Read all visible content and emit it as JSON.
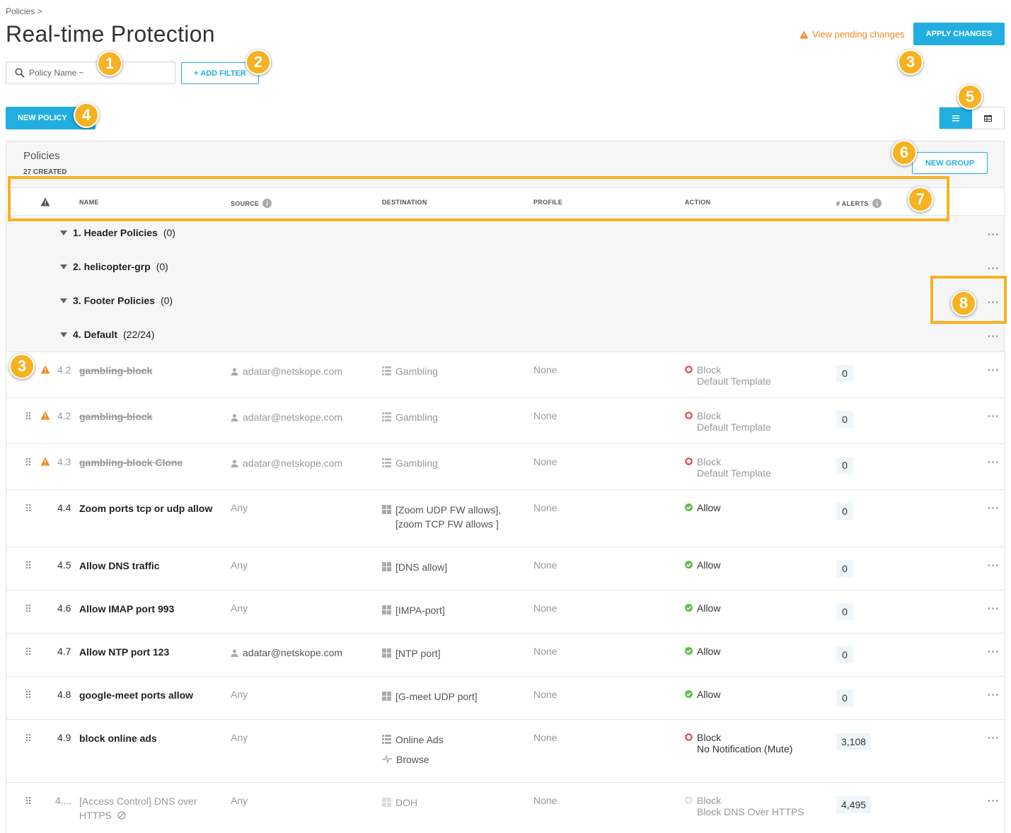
{
  "breadcrumb": "Policies >",
  "page_title": "Real-time Protection",
  "pending_link": "View pending changes",
  "apply_button": "APPLY CHANGES",
  "search": {
    "placeholder": "Policy Name ~",
    "icon": "search-icon"
  },
  "add_filter": "+ ADD FILTER",
  "new_policy": "NEW POLICY",
  "view_toggle": {
    "active": "list-view",
    "icons": [
      "list-icon",
      "table-icon"
    ]
  },
  "panel": {
    "title": "Policies",
    "subtitle": "27 CREATED",
    "new_group": "NEW GROUP"
  },
  "columns": {
    "name": "NAME",
    "source": "SOURCE",
    "destination": "DESTINATION",
    "profile": "PROFILE",
    "action": "ACTION",
    "alerts": "# ALERTS"
  },
  "groups": [
    {
      "label": "1. Header Policies",
      "count": "(0)"
    },
    {
      "label": "2. helicopter-grp",
      "count": "(0)"
    },
    {
      "label": "3. Footer Policies",
      "count": "(0)"
    },
    {
      "label": "4. Default",
      "count": "(22/24)"
    }
  ],
  "rows": [
    {
      "num": "4.2",
      "name": "gambling-block",
      "source": "adatar@netskope.com",
      "dest": "Gambling",
      "profile": "None",
      "action": "Block",
      "action_sub": "Default Template",
      "alerts": "0"
    },
    {
      "num": "4.2",
      "name": "gambling-block",
      "source": "adatar@netskope.com",
      "dest": "Gambling",
      "profile": "None",
      "action": "Block",
      "action_sub": "Default Template",
      "alerts": "0"
    },
    {
      "num": "4.3",
      "name": "gambling-block Clone",
      "source": "adatar@netskope.com",
      "dest": "Gambling",
      "profile": "None",
      "action": "Block",
      "action_sub": "Default Template",
      "alerts": "0"
    },
    {
      "num": "4.4",
      "name": "Zoom ports tcp or udp allow",
      "source": "Any",
      "dest": "[Zoom UDP FW allows],",
      "dest2": "[zoom TCP FW allows ]",
      "profile": "None",
      "action": "Allow",
      "alerts": "0"
    },
    {
      "num": "4.5",
      "name": "Allow DNS traffic",
      "source": "Any",
      "dest": "[DNS allow]",
      "profile": "None",
      "action": "Allow",
      "alerts": "0"
    },
    {
      "num": "4.6",
      "name": "Allow IMAP port 993",
      "source": "Any",
      "dest": "[IMPA-port]",
      "profile": "None",
      "action": "Allow",
      "alerts": "0"
    },
    {
      "num": "4.7",
      "name": "Allow NTP port 123",
      "source": "adatar@netskope.com",
      "dest": "[NTP port]",
      "profile": "None",
      "action": "Allow",
      "alerts": "0"
    },
    {
      "num": "4.8",
      "name": "google-meet ports allow",
      "source": "Any",
      "dest": "[G-meet UDP port]",
      "profile": "None",
      "action": "Allow",
      "alerts": "0"
    },
    {
      "num": "4.9",
      "name": "block online ads",
      "source": "Any",
      "dest": "Online Ads",
      "dest2": "Browse",
      "profile": "None",
      "action": "Block",
      "action_sub": "No Notification (Mute)",
      "alerts": "3,108"
    },
    {
      "num": "4....",
      "name": "[Access Control] DNS over",
      "name2": "HTTPS",
      "source": "Any",
      "dest": "DOH",
      "profile": "None",
      "action": "Block",
      "action_sub": "Block DNS Over HTTPS",
      "alerts": "4,495"
    }
  ],
  "callouts": [
    "1",
    "2",
    "3",
    "4",
    "5",
    "6",
    "7",
    "8",
    "3"
  ],
  "colors": {
    "accent": "#22aee0",
    "warning": "#f08a24",
    "callout": "#f6b221",
    "block": "#e8414a",
    "allow": "#5cbf4a"
  }
}
